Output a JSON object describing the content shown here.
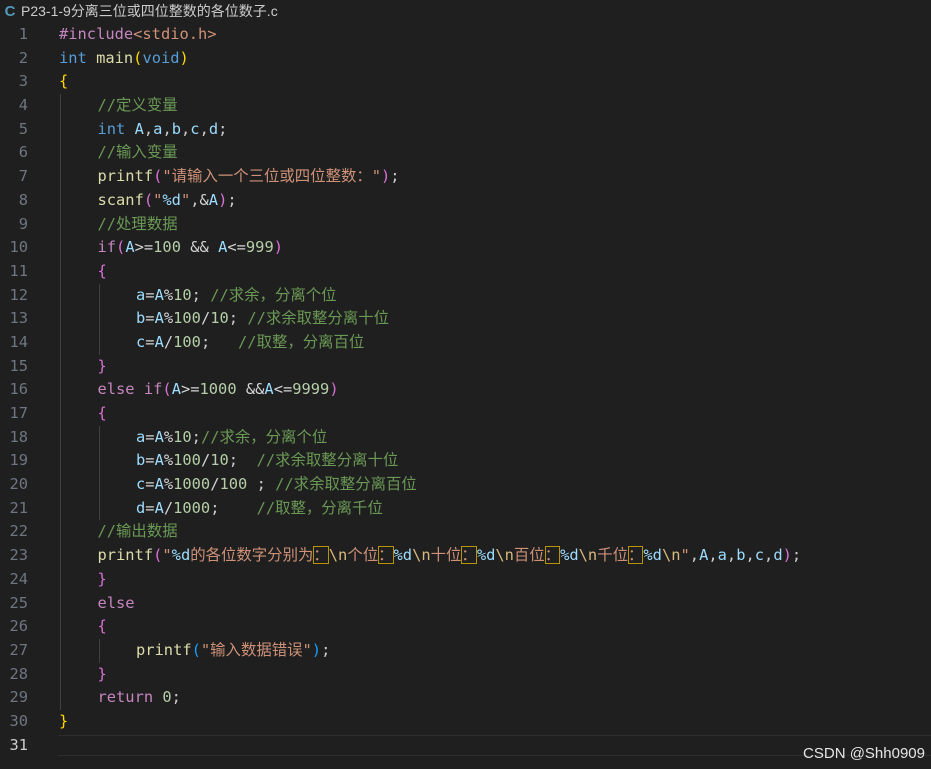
{
  "tab": {
    "icon_label": "C",
    "icon": "c-language-icon",
    "filename": "P23-1-9分离三位或四位整数的各位数子.c"
  },
  "watermark": "CSDN @Shh0909",
  "current_line": 31,
  "colors": {
    "background": "#1f1f1f",
    "keyword": "#569cd6",
    "string": "#ce9178",
    "comment": "#6a9955",
    "number": "#b5cea8",
    "function": "#dcdcaa",
    "variable": "#9cdcfe"
  },
  "lines": [
    {
      "n": "1",
      "indent": 0,
      "tokens": [
        [
          "#include",
          "preproc"
        ],
        [
          "<stdio.h>",
          "include"
        ]
      ]
    },
    {
      "n": "2",
      "indent": 0,
      "tokens": [
        [
          "int",
          "kw"
        ],
        [
          " "
        ],
        [
          "main",
          "fn"
        ],
        [
          "(",
          "p1"
        ],
        [
          "void",
          "kw"
        ],
        [
          ")",
          "p1"
        ]
      ]
    },
    {
      "n": "3",
      "indent": 0,
      "tokens": [
        [
          "{",
          "p1"
        ]
      ]
    },
    {
      "n": "4",
      "indent": 1,
      "tokens": [
        [
          "//定义变量",
          "cmt"
        ]
      ]
    },
    {
      "n": "5",
      "indent": 1,
      "tokens": [
        [
          "int",
          "kw"
        ],
        [
          " "
        ],
        [
          "A",
          "var"
        ],
        [
          ","
        ],
        [
          "a",
          "var"
        ],
        [
          ","
        ],
        [
          "b",
          "var"
        ],
        [
          ","
        ],
        [
          "c",
          "var"
        ],
        [
          ","
        ],
        [
          "d",
          "var"
        ],
        [
          ";"
        ]
      ]
    },
    {
      "n": "6",
      "indent": 1,
      "tokens": [
        [
          "//输入变量",
          "cmt"
        ]
      ]
    },
    {
      "n": "7",
      "indent": 1,
      "tokens": [
        [
          "printf",
          "fn"
        ],
        [
          "(",
          "p2"
        ],
        [
          "\"请输入一个三位或四位整数：\"",
          "str"
        ],
        [
          ")",
          "p2"
        ],
        [
          ";"
        ]
      ]
    },
    {
      "n": "8",
      "indent": 1,
      "tokens": [
        [
          "scanf",
          "fn"
        ],
        [
          "(",
          "p2"
        ],
        [
          "\"",
          "str"
        ],
        [
          "%d",
          "var"
        ],
        [
          "\"",
          "str"
        ],
        [
          ","
        ],
        [
          "&",
          "op"
        ],
        [
          "A",
          "var"
        ],
        [
          ")",
          "p2"
        ],
        [
          ";"
        ]
      ]
    },
    {
      "n": "9",
      "indent": 1,
      "tokens": [
        [
          "//处理数据",
          "cmt"
        ]
      ]
    },
    {
      "n": "10",
      "indent": 1,
      "tokens": [
        [
          "if",
          "ctrl"
        ],
        [
          "(",
          "p2"
        ],
        [
          "A",
          "var"
        ],
        [
          ">=",
          "op"
        ],
        [
          "100",
          "num"
        ],
        [
          " "
        ],
        [
          "&&",
          "op"
        ],
        [
          " "
        ],
        [
          "A",
          "var"
        ],
        [
          "<=",
          "op"
        ],
        [
          "999",
          "num"
        ],
        [
          ")",
          "p2"
        ]
      ]
    },
    {
      "n": "11",
      "indent": 1,
      "tokens": [
        [
          "{",
          "p2"
        ]
      ]
    },
    {
      "n": "12",
      "indent": 2,
      "tokens": [
        [
          "a",
          "var"
        ],
        [
          "=",
          "op"
        ],
        [
          "A",
          "var"
        ],
        [
          "%",
          "op"
        ],
        [
          "10",
          "num"
        ],
        [
          ";"
        ],
        [
          " "
        ],
        [
          "//求余，分离个位",
          "cmt"
        ]
      ]
    },
    {
      "n": "13",
      "indent": 2,
      "tokens": [
        [
          "b",
          "var"
        ],
        [
          "=",
          "op"
        ],
        [
          "A",
          "var"
        ],
        [
          "%",
          "op"
        ],
        [
          "100",
          "num"
        ],
        [
          "/",
          "op"
        ],
        [
          "10",
          "num"
        ],
        [
          ";"
        ],
        [
          " "
        ],
        [
          "//求余取整分离十位",
          "cmt"
        ]
      ]
    },
    {
      "n": "14",
      "indent": 2,
      "tokens": [
        [
          "c",
          "var"
        ],
        [
          "=",
          "op"
        ],
        [
          "A",
          "var"
        ],
        [
          "/",
          "op"
        ],
        [
          "100",
          "num"
        ],
        [
          ";"
        ],
        [
          "   "
        ],
        [
          "//取整，分离百位",
          "cmt"
        ]
      ]
    },
    {
      "n": "15",
      "indent": 1,
      "tokens": [
        [
          "}",
          "p2"
        ]
      ]
    },
    {
      "n": "16",
      "indent": 1,
      "tokens": [
        [
          "else",
          "ctrl"
        ],
        [
          " "
        ],
        [
          "if",
          "ctrl"
        ],
        [
          "(",
          "p2"
        ],
        [
          "A",
          "var"
        ],
        [
          ">=",
          "op"
        ],
        [
          "1000",
          "num"
        ],
        [
          " "
        ],
        [
          "&&",
          "op"
        ],
        [
          "A",
          "var"
        ],
        [
          "<=",
          "op"
        ],
        [
          "9999",
          "num"
        ],
        [
          ")",
          "p2"
        ]
      ]
    },
    {
      "n": "17",
      "indent": 1,
      "tokens": [
        [
          "{",
          "p2"
        ]
      ]
    },
    {
      "n": "18",
      "indent": 2,
      "tokens": [
        [
          "a",
          "var"
        ],
        [
          "=",
          "op"
        ],
        [
          "A",
          "var"
        ],
        [
          "%",
          "op"
        ],
        [
          "10",
          "num"
        ],
        [
          ";"
        ],
        [
          "//求余，分离个位",
          "cmt"
        ]
      ]
    },
    {
      "n": "19",
      "indent": 2,
      "tokens": [
        [
          "b",
          "var"
        ],
        [
          "=",
          "op"
        ],
        [
          "A",
          "var"
        ],
        [
          "%",
          "op"
        ],
        [
          "100",
          "num"
        ],
        [
          "/",
          "op"
        ],
        [
          "10",
          "num"
        ],
        [
          ";"
        ],
        [
          "  "
        ],
        [
          "//求余取整分离十位",
          "cmt"
        ]
      ]
    },
    {
      "n": "20",
      "indent": 2,
      "tokens": [
        [
          "c",
          "var"
        ],
        [
          "=",
          "op"
        ],
        [
          "A",
          "var"
        ],
        [
          "%",
          "op"
        ],
        [
          "1000",
          "num"
        ],
        [
          "/",
          "op"
        ],
        [
          "100",
          "num"
        ],
        [
          " "
        ],
        [
          ";"
        ],
        [
          " "
        ],
        [
          "//求余取整分离百位",
          "cmt"
        ]
      ]
    },
    {
      "n": "21",
      "indent": 2,
      "tokens": [
        [
          "d",
          "var"
        ],
        [
          "=",
          "op"
        ],
        [
          "A",
          "var"
        ],
        [
          "/",
          "op"
        ],
        [
          "1000",
          "num"
        ],
        [
          ";"
        ],
        [
          "    "
        ],
        [
          "//取整，分离千位",
          "cmt"
        ]
      ]
    },
    {
      "n": "22",
      "indent": 1,
      "tokens": [
        [
          "//输出数据",
          "cmt"
        ]
      ]
    },
    {
      "n": "23",
      "indent": 1,
      "tokens": [
        [
          "printf",
          "fn"
        ],
        [
          "(",
          "p2"
        ],
        [
          "\"",
          "str"
        ],
        [
          "%d",
          "var"
        ],
        [
          "的各位数字分别为",
          "str"
        ],
        [
          "：",
          "hl"
        ],
        [
          "\\n",
          "esc"
        ],
        [
          "个位",
          "str"
        ],
        [
          "：",
          "hl"
        ],
        [
          "%d",
          "var"
        ],
        [
          "\\n",
          "esc"
        ],
        [
          "十位",
          "str"
        ],
        [
          "：",
          "hl"
        ],
        [
          "%d",
          "var"
        ],
        [
          "\\n",
          "esc"
        ],
        [
          "百位",
          "str"
        ],
        [
          "：",
          "hl"
        ],
        [
          "%d",
          "var"
        ],
        [
          "\\n",
          "esc"
        ],
        [
          "千位",
          "str"
        ],
        [
          "：",
          "hl"
        ],
        [
          "%d",
          "var"
        ],
        [
          "\\n",
          "esc"
        ],
        [
          "\"",
          "str"
        ],
        [
          ","
        ],
        [
          "A",
          "var"
        ],
        [
          ","
        ],
        [
          "a",
          "var"
        ],
        [
          ","
        ],
        [
          "b",
          "var"
        ],
        [
          ","
        ],
        [
          "c",
          "var"
        ],
        [
          ","
        ],
        [
          "d",
          "var"
        ],
        [
          ")",
          "p2"
        ],
        [
          ";"
        ]
      ]
    },
    {
      "n": "24",
      "indent": 1,
      "tokens": [
        [
          "}",
          "p2"
        ]
      ]
    },
    {
      "n": "25",
      "indent": 1,
      "tokens": [
        [
          "else",
          "ctrl"
        ]
      ]
    },
    {
      "n": "26",
      "indent": 1,
      "tokens": [
        [
          "{",
          "p2"
        ]
      ]
    },
    {
      "n": "27",
      "indent": 2,
      "tokens": [
        [
          "printf",
          "fn"
        ],
        [
          "(",
          "p3"
        ],
        [
          "\"输入数据错误\"",
          "str"
        ],
        [
          ")",
          "p3"
        ],
        [
          ";"
        ]
      ]
    },
    {
      "n": "28",
      "indent": 1,
      "tokens": [
        [
          "}",
          "p2"
        ]
      ]
    },
    {
      "n": "29",
      "indent": 1,
      "tokens": [
        [
          "return",
          "ctrl"
        ],
        [
          " "
        ],
        [
          "0",
          "num"
        ],
        [
          ";"
        ]
      ]
    },
    {
      "n": "30",
      "indent": 0,
      "tokens": [
        [
          "}",
          "p1"
        ]
      ]
    },
    {
      "n": "31",
      "indent": 0,
      "tokens": []
    }
  ]
}
